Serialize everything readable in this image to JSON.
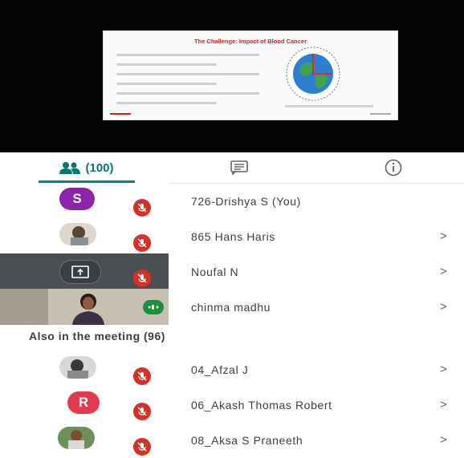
{
  "slide": {
    "title": "The Challenge: Impact of Blood Cancer"
  },
  "tabs": {
    "people_count": "(100)"
  },
  "participants": [
    {
      "initial": "S",
      "name": "726-Drishya S (You)",
      "avatar_color": "#8e24aa",
      "chevron": ""
    },
    {
      "name": "865 Hans Haris",
      "chevron": ">"
    },
    {
      "name": "Noufal N",
      "chevron": ">"
    },
    {
      "name": "chinma madhu",
      "chevron": ">"
    }
  ],
  "also_in_meeting": {
    "label": "Also in the meeting (96)",
    "participants": [
      {
        "name": "04_Afzal J",
        "chevron": ">"
      },
      {
        "initial": "R",
        "name": "06_Akash Thomas Robert",
        "avatar_color": "#e53950",
        "chevron": ">"
      },
      {
        "name": "08_Aksa S Praneeth",
        "chevron": ">"
      }
    ]
  },
  "colors": {
    "accent": "#00897b",
    "mute_red": "#d93025",
    "stage_bg": "#050505"
  },
  "icons": {
    "people": "people-icon",
    "chat": "chat-icon",
    "info": "info-icon",
    "mic_off": "mic-off-icon",
    "present": "present-screen-icon"
  }
}
